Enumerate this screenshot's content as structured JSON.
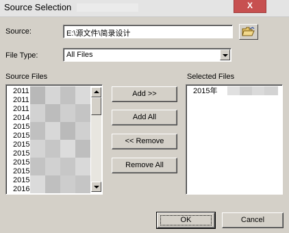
{
  "window": {
    "title": "Source Selection",
    "close_label": "X"
  },
  "source": {
    "label": "Source:",
    "value": "E:\\源文件\\简录设计"
  },
  "file_type": {
    "label": "File Type:",
    "value": "All Files"
  },
  "source_files": {
    "label": "Source Files",
    "items": [
      "2011",
      "2011",
      "2011",
      "2014",
      "2015",
      "2015",
      "2015",
      "2015",
      "2015",
      "2015",
      "2015",
      "2016"
    ]
  },
  "selected_files": {
    "label": "Selected Files",
    "items": [
      "2015年"
    ]
  },
  "actions": {
    "add": "Add >>",
    "add_all": "Add All",
    "remove": "<< Remove",
    "remove_all": "Remove All"
  },
  "footer": {
    "ok": "OK",
    "cancel": "Cancel"
  },
  "icons": {
    "folder": "folder-open-icon",
    "close": "close-icon"
  }
}
